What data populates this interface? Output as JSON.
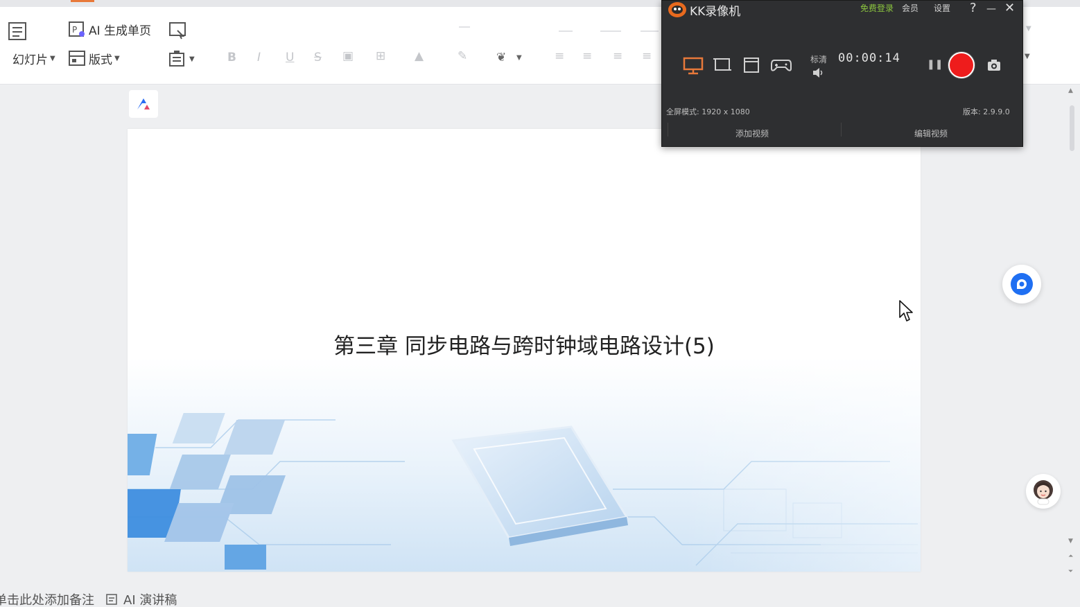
{
  "ribbon": {
    "ai_single_page": "AI 生成单页",
    "slideshow_partial": "幻灯片",
    "layout_label": "版式"
  },
  "slide": {
    "title": "第三章  同步电路与跨时钟域电路设计(5)"
  },
  "notes": {
    "placeholder": "单击此处添加备注",
    "ai_script": "AI 演讲稿"
  },
  "recorder": {
    "app_title": "KK录像机",
    "login": "免费登录",
    "vip": "会员",
    "settings": "设置",
    "help": "?",
    "minimize": "—",
    "close": "✕",
    "quality": "标清",
    "timer": "00:00:14",
    "mode_info": "全屏模式: 1920 x 1080",
    "version": "版本: 2.9.9.0",
    "add_video": "添加视频",
    "edit_video": "编辑视频"
  },
  "colors": {
    "record": "#ee1c1c",
    "slide_accent": "#8fc3ee",
    "logo_blue": "#2a6df4",
    "brand_orange": "#e8793a"
  }
}
